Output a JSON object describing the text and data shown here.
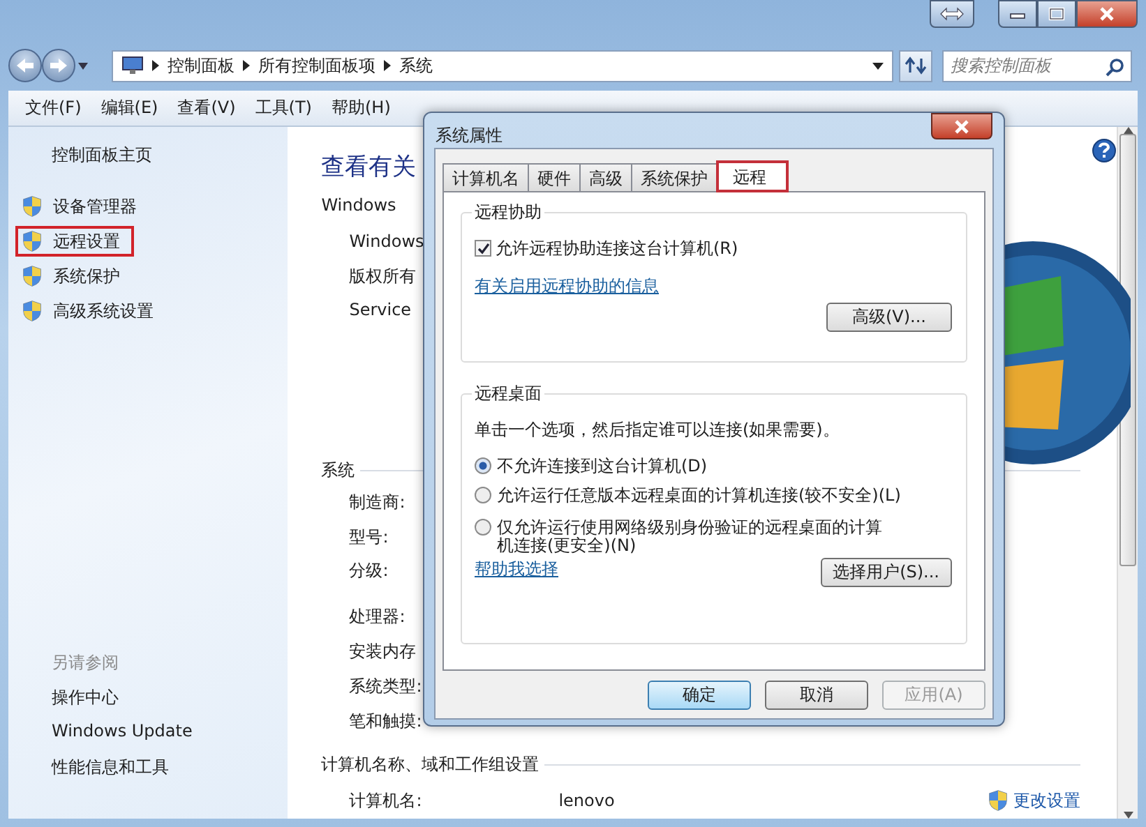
{
  "address_bar": {
    "path": [
      "控制面板",
      "所有控制面板项",
      "系统"
    ]
  },
  "search": {
    "placeholder": "搜索控制面板"
  },
  "menu": [
    "文件(F)",
    "编辑(E)",
    "查看(V)",
    "工具(T)",
    "帮助(H)"
  ],
  "sidebar": {
    "home": "控制面板主页",
    "tasks": [
      {
        "label": "设备管理器",
        "highlighted": false
      },
      {
        "label": "远程设置",
        "highlighted": true
      },
      {
        "label": "系统保护",
        "highlighted": false
      },
      {
        "label": "高级系统设置",
        "highlighted": false
      }
    ],
    "see_also_title": "另请参阅",
    "see_also": [
      "操作中心",
      "Windows Update",
      "性能信息和工具"
    ]
  },
  "main": {
    "heading": "查看有关",
    "edition": {
      "title": "Windows",
      "rows": [
        "Windows",
        "版权所有",
        "Service"
      ]
    },
    "system": {
      "title": "系统",
      "rows": [
        "制造商:",
        "型号:",
        "分级:",
        "处理器:",
        "安装内存",
        "系统类型:",
        "笔和触摸:"
      ]
    },
    "computer": {
      "title": "计算机名称、域和工作组设置",
      "rows": [
        {
          "label": "计算机名:",
          "value": "lenovo"
        }
      ],
      "change_link": "更改设置"
    }
  },
  "dialog": {
    "title": "系统属性",
    "tabs": [
      {
        "label": "计算机名",
        "selected": false,
        "highlighted": false
      },
      {
        "label": "硬件",
        "selected": false,
        "highlighted": false
      },
      {
        "label": "高级",
        "selected": false,
        "highlighted": false
      },
      {
        "label": "系统保护",
        "selected": false,
        "highlighted": false
      },
      {
        "label": "远程",
        "selected": true,
        "highlighted": true
      }
    ],
    "assistance": {
      "title": "远程协助",
      "checkbox": {
        "label": "允许远程协助连接这台计算机(R)",
        "checked": true
      },
      "link": "有关启用远程协助的信息",
      "button": "高级(V)..."
    },
    "desktop": {
      "title": "远程桌面",
      "instruction": "单击一个选项，然后指定谁可以连接(如果需要)。",
      "options": [
        {
          "label": "不允许连接到这台计算机(D)",
          "selected": true
        },
        {
          "label": "允许运行任意版本远程桌面的计算机连接(较不安全)(L)",
          "selected": false
        },
        {
          "label": "仅允许运行使用网络级别身份验证的远程桌面的计算机连接(更安全)(N)",
          "selected": false
        }
      ],
      "link": "帮助我选择",
      "button": "选择用户(S)..."
    },
    "buttons": [
      {
        "label": "确定",
        "default": true,
        "disabled": false
      },
      {
        "label": "取消",
        "default": false,
        "disabled": false
      },
      {
        "label": "应用(A)",
        "default": false,
        "disabled": true
      }
    ]
  }
}
